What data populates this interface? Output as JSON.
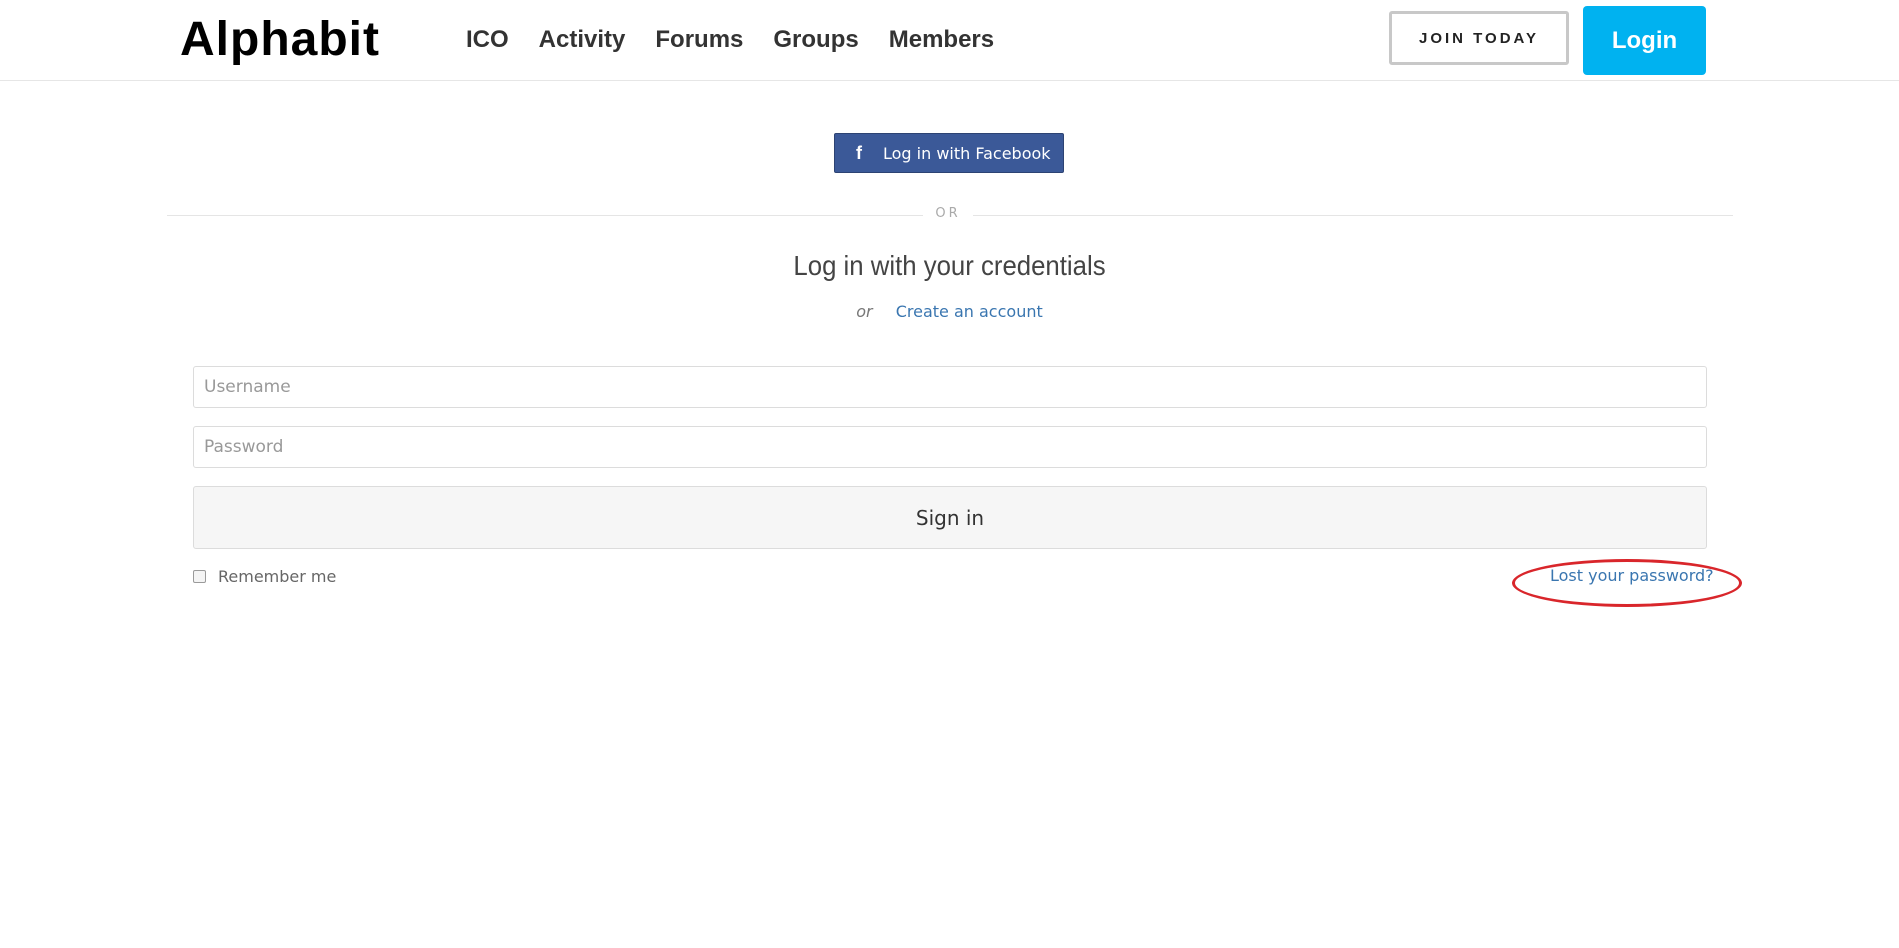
{
  "header": {
    "logo": "Alphabit",
    "nav": [
      "ICO",
      "Activity",
      "Forums",
      "Groups",
      "Members"
    ],
    "join_label": "JOIN TODAY",
    "login_label": "Login"
  },
  "social": {
    "facebook_icon": "f",
    "facebook_label": "Log in with Facebook"
  },
  "divider": {
    "text": "OR"
  },
  "form": {
    "heading": "Log in with your credentials",
    "or_text": "or",
    "create_account": "Create an account",
    "username_placeholder": "Username",
    "password_placeholder": "Password",
    "signin_label": "Sign in",
    "remember_label": "Remember me",
    "lost_password": "Lost your password?"
  },
  "colors": {
    "brand_accent": "#00b2f0",
    "facebook": "#3b5998",
    "link": "#3a76b0",
    "annotation": "#d9262b"
  }
}
